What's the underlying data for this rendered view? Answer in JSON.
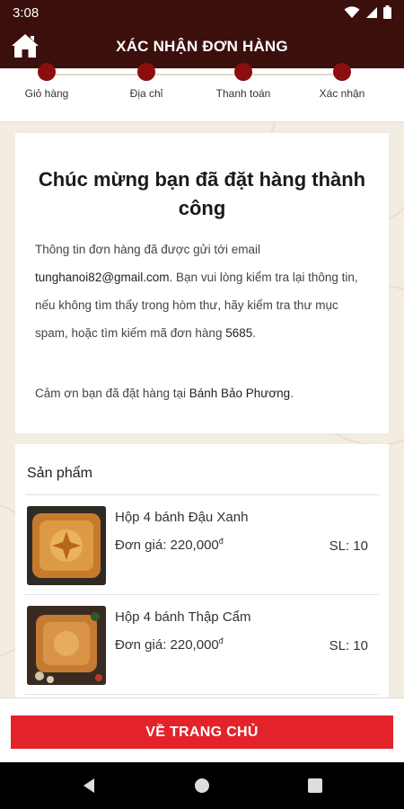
{
  "status_bar": {
    "time": "3:08"
  },
  "header": {
    "title": "XÁC NHẬN ĐƠN HÀNG",
    "home_icon": "home-icon"
  },
  "steps": [
    {
      "label": "Giỏ hàng"
    },
    {
      "label": "Địa chỉ"
    },
    {
      "label": "Thanh toán"
    },
    {
      "label": "Xác nhận"
    }
  ],
  "confirmation": {
    "title": "Chúc mừng bạn đã đặt hàng thành công",
    "msg_part1": "Thông tin đơn hàng đã được gửi tới email ",
    "email": "tunghanoi82@gmail.com",
    "msg_part2": ". Bạn vui lòng kiểm tra lại thông tin, nếu không tìm thấy trong hòm thư, hãy kiểm tra thư mục spam, hoặc tìm kiếm mã đơn hàng ",
    "order_code": "5685",
    "msg_part3": ".",
    "thanks_part1": "Cảm ơn bạn đã đặt hàng tại ",
    "shop_name": "Bánh Bảo Phương",
    "thanks_part2": "."
  },
  "products": {
    "header": "Sản phẩm",
    "items": [
      {
        "name": "Hộp 4 bánh Đậu Xanh",
        "price_label": "Đơn giá: ",
        "price": "220,000",
        "currency": "đ",
        "qty": "SL: 10"
      },
      {
        "name": "Hộp 4 bánh Thập Cẩm",
        "price_label": "Đơn giá: ",
        "price": "220,000",
        "currency": "đ",
        "qty": "SL: 10"
      }
    ]
  },
  "bottom_button": {
    "label": "VỀ TRANG CHỦ"
  },
  "colors": {
    "header_bg": "#3a0f0c",
    "accent": "#8b0d0d",
    "button_bg": "#e3222a"
  }
}
